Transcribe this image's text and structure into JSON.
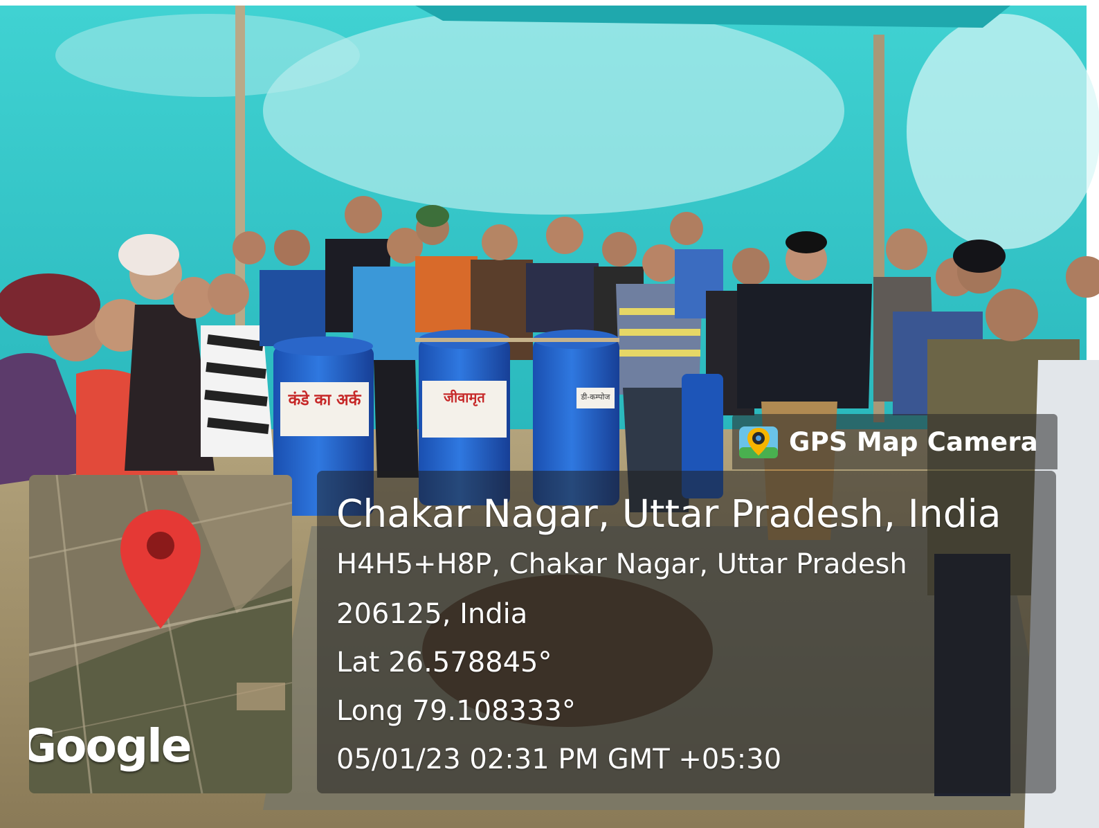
{
  "overlay": {
    "brand": "GPS Map Camera",
    "map_watermark": "Google",
    "location_title": "Chakar Nagar, Uttar Pradesh, India",
    "address_line": "H4H5+H8P, Chakar Nagar, Uttar Pradesh",
    "pincode_line": "206125, India",
    "latitude": "Lat 26.578845°",
    "longitude": "Long 79.108333°",
    "datetime": "05/01/23 02:31 PM GMT +05:30"
  },
  "drums": [
    {
      "label": "कंडे का अर्क"
    },
    {
      "label": "जीवामृत"
    },
    {
      "label": "डी-कम्पोज"
    }
  ],
  "icons": {
    "brand_logo": "gps-map-camera-logo-icon",
    "map_pin": "map-pin-icon"
  },
  "colors": {
    "shade_net": "#2ec4c4",
    "drum_blue": "#1f5fc8",
    "pin_red": "#e53935"
  }
}
